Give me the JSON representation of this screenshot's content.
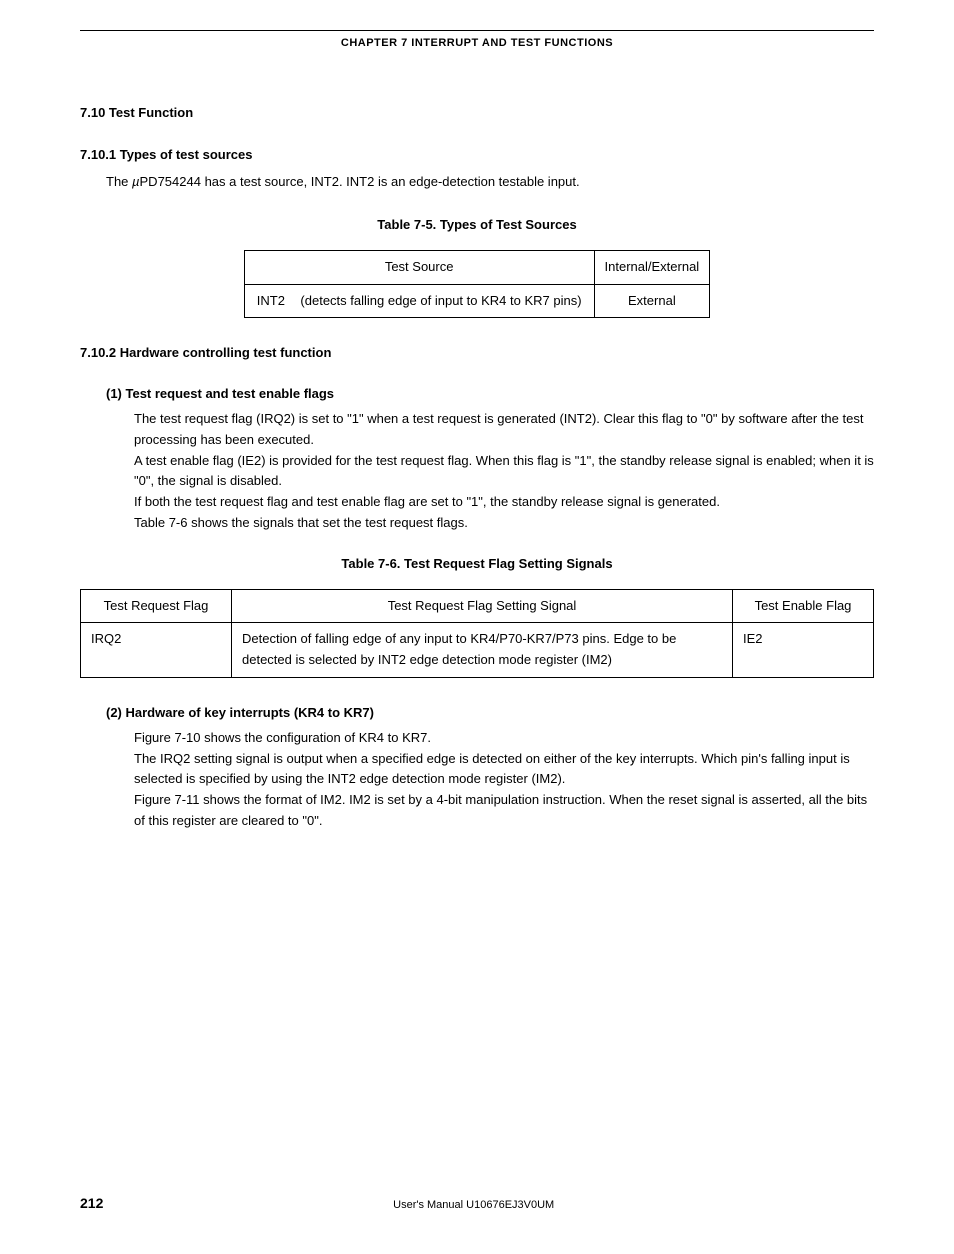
{
  "chapter_header": "CHAPTER 7   INTERRUPT AND TEST FUNCTIONS",
  "section_title": "7.10  Test Function",
  "subsection1_title": "7.10.1  Types of test sources",
  "intro_prefix": "The ",
  "intro_mu": "µ",
  "intro_rest": "PD754244 has a test source, INT2.  INT2 is an edge-detection testable input.",
  "table1_caption": "Table 7-5.  Types of Test Sources",
  "table1": {
    "h1": "Test Source",
    "h2": "Internal/External",
    "r1c1a": "INT2",
    "r1c1b": "(detects falling edge of input to KR4 to KR7 pins)",
    "r1c2": "External"
  },
  "subsection2_title": "7.10.2  Hardware controlling test function",
  "item1_title": "(1)   Test request and test enable flags",
  "item1_p1": "The test request flag (IRQ2) is set to \"1\" when a test request is generated (INT2).  Clear this flag to \"0\" by software after the test processing has been executed.",
  "item1_p2": "A test enable flag (IE2) is provided for the test request flag.  When this flag is \"1\", the standby release signal is enabled; when it is \"0\", the signal is disabled.",
  "item1_p3": "If both the test request flag and test enable flag are set to \"1\", the standby release signal is generated.",
  "item1_p4": "Table 7-6 shows the signals that set the test request flags.",
  "table2_caption": "Table 7-6.  Test Request Flag Setting Signals",
  "table2": {
    "h1": "Test Request Flag",
    "h2": "Test Request Flag Setting Signal",
    "h3": "Test Enable Flag",
    "r1c1": "IRQ2",
    "r1c2": "Detection of falling edge of any input to KR4/P70-KR7/P73 pins. Edge to be detected is selected by INT2 edge detection mode register (IM2)",
    "r1c3": "IE2"
  },
  "item2_title": "(2)   Hardware of key interrupts (KR4 to KR7)",
  "item2_p1": "Figure 7-10 shows the configuration of KR4 to KR7.",
  "item2_p2": "The IRQ2 setting signal is output when a specified edge is detected on either of the key interrupts.  Which pin's falling input is selected is specified by using the INT2 edge detection mode register (IM2).",
  "item2_p3": "Figure 7-11 shows the format of IM2.  IM2 is set by a 4-bit manipulation instruction.  When the reset signal is asserted, all the bits of this register are cleared to \"0\".",
  "page_number": "212",
  "manual_ref": "User's Manual  U10676EJ3V0UM"
}
